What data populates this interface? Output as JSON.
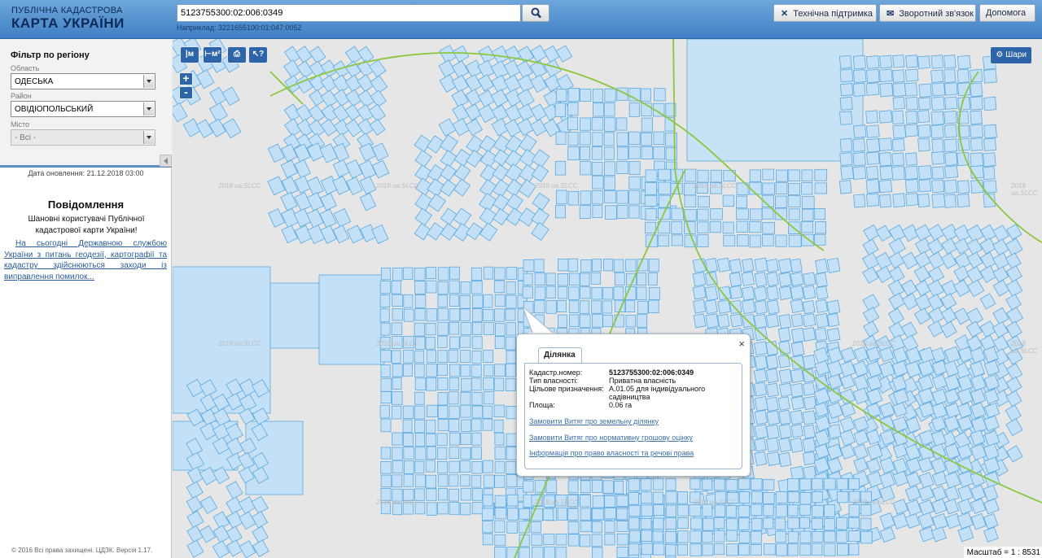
{
  "header": {
    "brand_line1": "ПУБЛІЧНА КАДАСТРОВА",
    "brand_line2": "КАРТА УКРАЇНИ",
    "search_value": "5123755300:02:006:0349",
    "example_text": "Наприклад: 3221655100:01:047:0052",
    "buttons": [
      {
        "label": "Технічна підтримка",
        "icon": "tools-icon"
      },
      {
        "label": "Зворотний зв'язок",
        "icon": "envelope-icon"
      },
      {
        "label": "Допомога",
        "icon": ""
      }
    ]
  },
  "sidebar": {
    "filter_title": "Фільтр по регіону",
    "region_label": "Область",
    "region_value": "ОДЕСЬКА",
    "district_label": "Район",
    "district_value": "ОВІДІОПОЛЬСЬКИЙ",
    "city_label": "Місто",
    "city_value": "- Всі -",
    "updated": "Дата оновлення: 21.12.2018 03:00",
    "notice_title": "Повідомлення",
    "notice_greeting": "Шановні користувачі Публічної кадастрової карти України!",
    "notice_link": "На сьогодні Державною службою України з питань геодезії, картографії та кадастру здійснюються заходи із виправлення помилок...",
    "copyright": "© 2016 Всі права захищені. ЦДЗК. Версія 1.17."
  },
  "map": {
    "tools": [
      {
        "label": "|м",
        "icon": "measure-distance-icon"
      },
      {
        "label": "⊢м²",
        "icon": "measure-area-icon"
      },
      {
        "label": "⎙",
        "icon": "print-icon"
      },
      {
        "label": "↖?",
        "icon": "identify-icon"
      }
    ],
    "zoom_in": "+",
    "zoom_out": "-",
    "layers_label": "Шари",
    "scale": "Масштаб = 1 : 8531",
    "watermark": "2018 ua.SLCC"
  },
  "popup": {
    "tab_label": "Ділянка",
    "close_symbol": "×",
    "rows": [
      {
        "key": "Кадастр.номер:",
        "value": "5123755300:02:006:0349"
      },
      {
        "key": "Тип власності:",
        "value": "Приватна власність"
      },
      {
        "key": "Цільове призначення:",
        "value": "А.01.05 для індивідуального садівництва"
      },
      {
        "key": "Площа:",
        "value": "0.06 га"
      }
    ],
    "links": [
      "Замовити Витяг про земельну ділянку",
      "Замовити Витяг про нормативну грошову оцінку",
      "Інформація про право власності та речові права"
    ]
  },
  "colors": {
    "header": "#4f8ccc",
    "parcel_fill": "#c3e0f6",
    "parcel_stroke": "#5ba9e0",
    "boundary": "#8cc63f",
    "tool_bg": "#2e64a8"
  }
}
